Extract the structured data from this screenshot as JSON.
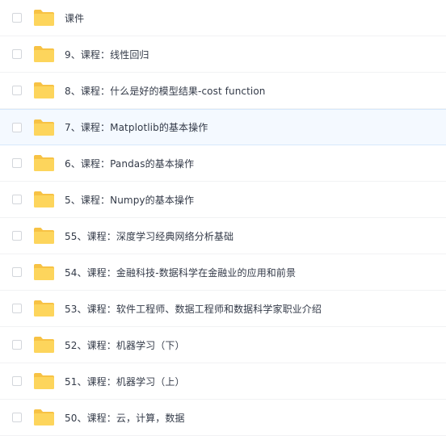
{
  "files": [
    {
      "name": "课件",
      "highlighted": false
    },
    {
      "name": "9、课程：线性回归",
      "highlighted": false
    },
    {
      "name": "8、课程：什么是好的模型结果-cost function",
      "highlighted": false
    },
    {
      "name": "7、课程：Matplotlib的基本操作",
      "highlighted": true
    },
    {
      "name": "6、课程：Pandas的基本操作",
      "highlighted": false
    },
    {
      "name": "5、课程：Numpy的基本操作",
      "highlighted": false
    },
    {
      "name": "55、课程：深度学习经典网络分析基础",
      "highlighted": false
    },
    {
      "name": "54、课程：金融科技-数据科学在金融业的应用和前景",
      "highlighted": false
    },
    {
      "name": "53、课程：软件工程师、数据工程师和数据科学家职业介绍",
      "highlighted": false
    },
    {
      "name": "52、课程：机器学习（下）",
      "highlighted": false
    },
    {
      "name": "51、课程：机器学习（上）",
      "highlighted": false
    },
    {
      "name": "50、课程：云，计算，数据",
      "highlighted": false
    }
  ],
  "icon": "folder-icon",
  "colors": {
    "folder_back": "#f7c244",
    "folder_front": "#fdd55c",
    "text": "#333a48",
    "highlight_bg": "#f4f9ff"
  }
}
